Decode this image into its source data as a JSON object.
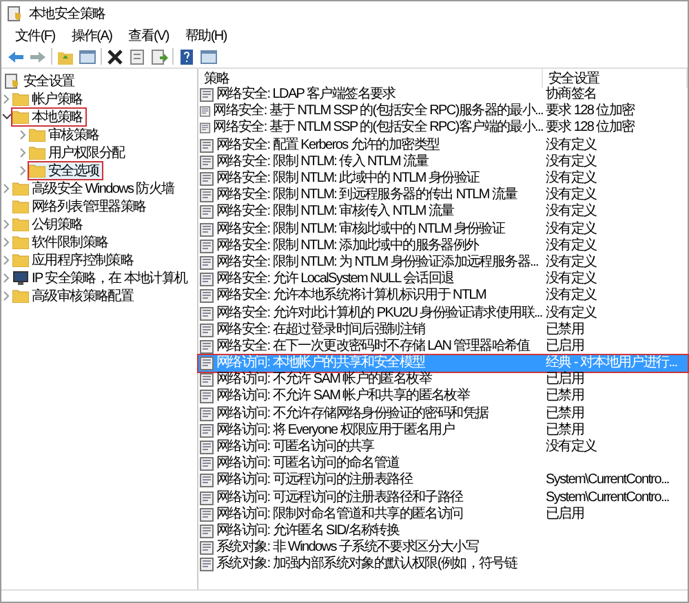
{
  "window": {
    "title": "本地安全策略"
  },
  "menu": [
    "文件(F)",
    "操作(A)",
    "查看(V)",
    "帮助(H)"
  ],
  "toolbar": [
    {
      "kind": "back"
    },
    {
      "kind": "forward"
    },
    {
      "kind": "sep"
    },
    {
      "kind": "up"
    },
    {
      "kind": "pane"
    },
    {
      "kind": "sep"
    },
    {
      "kind": "delete"
    },
    {
      "kind": "properties"
    },
    {
      "kind": "export"
    },
    {
      "kind": "sep"
    },
    {
      "kind": "help"
    },
    {
      "kind": "pane"
    }
  ],
  "tree": {
    "label": "安全设置",
    "items": [
      {
        "label": "帐户策略",
        "kind": "folder",
        "expandable": true,
        "expanded": false,
        "annotated": false,
        "selected": false
      },
      {
        "label": "本地策略",
        "kind": "folder",
        "expandable": true,
        "expanded": true,
        "annotated": true,
        "selected": false,
        "children": [
          {
            "label": "审核策略",
            "kind": "folder",
            "expandable": true,
            "expanded": false,
            "annotated": false,
            "selected": false
          },
          {
            "label": "用户权限分配",
            "kind": "folder",
            "expandable": true,
            "expanded": false,
            "annotated": false,
            "selected": false
          },
          {
            "label": "安全选项",
            "kind": "folder",
            "expandable": true,
            "expanded": false,
            "annotated": true,
            "selected": true
          }
        ]
      },
      {
        "label": "高级安全 Windows 防火墙",
        "kind": "folder",
        "expandable": true,
        "expanded": false,
        "annotated": false,
        "selected": false
      },
      {
        "label": "网络列表管理器策略",
        "kind": "folder",
        "expandable": false,
        "annotated": false,
        "selected": false
      },
      {
        "label": "公钥策略",
        "kind": "folder",
        "expandable": true,
        "expanded": false,
        "annotated": false,
        "selected": false
      },
      {
        "label": "软件限制策略",
        "kind": "folder",
        "expandable": true,
        "expanded": false,
        "annotated": false,
        "selected": false
      },
      {
        "label": "应用程序控制策略",
        "kind": "folder",
        "expandable": true,
        "expanded": false,
        "annotated": false,
        "selected": false
      },
      {
        "label": "IP 安全策略，在 本地计算机",
        "kind": "computer",
        "expandable": true,
        "expanded": false,
        "annotated": false,
        "selected": false
      },
      {
        "label": "高级审核策略配置",
        "kind": "folder",
        "expandable": true,
        "expanded": false,
        "annotated": false,
        "selected": false
      }
    ]
  },
  "table": {
    "columns": [
      "策略",
      "安全设置"
    ],
    "rows": [
      {
        "policy": "网络安全: LDAP 客户端签名要求",
        "setting": "协商签名",
        "selected": false,
        "annotated": false
      },
      {
        "policy": "网络安全: 基于 NTLM SSP 的(包括安全 RPC)服务器的最小...",
        "setting": "要求 128 位加密",
        "selected": false,
        "annotated": false
      },
      {
        "policy": "网络安全: 基于 NTLM SSP 的(包括安全 RPC)客户端的最小...",
        "setting": "要求 128 位加密",
        "selected": false,
        "annotated": false
      },
      {
        "policy": "网络安全: 配置 Kerberos 允许的加密类型",
        "setting": "没有定义",
        "selected": false,
        "annotated": false
      },
      {
        "policy": "网络安全: 限制 NTLM: 传入 NTLM 流量",
        "setting": "没有定义",
        "selected": false,
        "annotated": false
      },
      {
        "policy": "网络安全: 限制 NTLM: 此域中的 NTLM 身份验证",
        "setting": "没有定义",
        "selected": false,
        "annotated": false
      },
      {
        "policy": "网络安全: 限制 NTLM: 到远程服务器的传出 NTLM 流量",
        "setting": "没有定义",
        "selected": false,
        "annotated": false
      },
      {
        "policy": "网络安全: 限制 NTLM: 审核传入 NTLM 流量",
        "setting": "没有定义",
        "selected": false,
        "annotated": false
      },
      {
        "policy": "网络安全: 限制 NTLM: 审核此域中的 NTLM 身份验证",
        "setting": "没有定义",
        "selected": false,
        "annotated": false
      },
      {
        "policy": "网络安全: 限制 NTLM: 添加此域中的服务器例外",
        "setting": "没有定义",
        "selected": false,
        "annotated": false
      },
      {
        "policy": "网络安全: 限制 NTLM: 为 NTLM 身份验证添加远程服务器...",
        "setting": "没有定义",
        "selected": false,
        "annotated": false
      },
      {
        "policy": "网络安全: 允许 LocalSystem NULL 会话回退",
        "setting": "没有定义",
        "selected": false,
        "annotated": false
      },
      {
        "policy": "网络安全: 允许本地系统将计算机标识用于 NTLM",
        "setting": "没有定义",
        "selected": false,
        "annotated": false
      },
      {
        "policy": "网络安全: 允许对此计算机的 PKU2U 身份验证请求使用联...",
        "setting": "没有定义",
        "selected": false,
        "annotated": false
      },
      {
        "policy": "网络安全: 在超过登录时间后强制注销",
        "setting": "已禁用",
        "selected": false,
        "annotated": false
      },
      {
        "policy": "网络安全: 在下一次更改密码时不存储 LAN 管理器哈希值",
        "setting": "已启用",
        "selected": false,
        "annotated": false
      },
      {
        "policy": "网络访问: 本地帐户的共享和安全模型",
        "setting": "经典 - 对本地用户进行...",
        "selected": true,
        "annotated": true
      },
      {
        "policy": "网络访问: 不允许 SAM 帐户的匿名枚举",
        "setting": "已启用",
        "selected": false,
        "annotated": false
      },
      {
        "policy": "网络访问: 不允许 SAM 帐户和共享的匿名枚举",
        "setting": "已禁用",
        "selected": false,
        "annotated": false
      },
      {
        "policy": "网络访问: 不允许存储网络身份验证的密码和凭据",
        "setting": "已禁用",
        "selected": false,
        "annotated": false
      },
      {
        "policy": "网络访问: 将 Everyone 权限应用于匿名用户",
        "setting": "已禁用",
        "selected": false,
        "annotated": false
      },
      {
        "policy": "网络访问: 可匿名访问的共享",
        "setting": "没有定义",
        "selected": false,
        "annotated": false
      },
      {
        "policy": "网络访问: 可匿名访问的命名管道",
        "selected": false,
        "annotated": false
      },
      {
        "policy": "网络访问: 可远程访问的注册表路径",
        "setting": "System\\CurrentContro...",
        "selected": false,
        "annotated": false
      },
      {
        "policy": "网络访问: 可远程访问的注册表路径和子路径",
        "setting": "System\\CurrentContro...",
        "selected": false,
        "annotated": false
      },
      {
        "policy": "网络访问: 限制对命名管道和共享的匿名访问",
        "setting": "已启用",
        "selected": false,
        "annotated": false
      },
      {
        "policy": "网络访问: 允许匿名 SID/名称转换",
        "selected": false,
        "annotated": false
      },
      {
        "policy": "系统对象: 非 Windows 子系统不要求区分大小写",
        "selected": false,
        "annotated": false
      },
      {
        "policy": "系统对象: 加强内部系统对象的默认权限(例如，符号链",
        "selected": false,
        "annotated": false
      }
    ]
  }
}
